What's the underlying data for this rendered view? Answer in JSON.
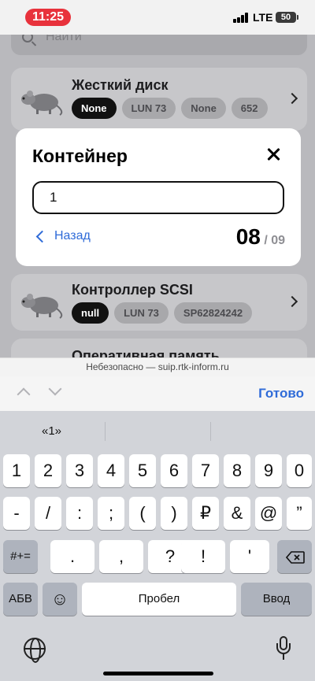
{
  "status_bar": {
    "time": "11:25",
    "network": "LTE",
    "battery": "50"
  },
  "page": {
    "search_placeholder": "Найти",
    "cards": [
      {
        "title": "Жесткий диск",
        "chips": [
          "None",
          "LUN 73",
          "None",
          "652"
        ]
      },
      {
        "title": "Контроллер SCSI",
        "chips": [
          "null",
          "LUN 73",
          "SP62824242"
        ]
      },
      {
        "title": "Оперативная память"
      }
    ]
  },
  "modal": {
    "title": "Контейнер",
    "input_value": "1",
    "back_label": "Назад",
    "current_page": "08",
    "total_pages": "/ 09"
  },
  "address_bar": "Небезопасно — suip.rtk-inform.ru",
  "toolbar": {
    "done_label": "Готово"
  },
  "keyboard": {
    "suggestion": "«1»",
    "row1": [
      "1",
      "2",
      "3",
      "4",
      "5",
      "6",
      "7",
      "8",
      "9",
      "0"
    ],
    "row2": [
      "-",
      "/",
      ":",
      ";",
      "(",
      ")",
      "₽",
      "&",
      "@",
      "”"
    ],
    "row3_mode": "#+=",
    "row3": [
      ".",
      ",",
      "?",
      "!",
      "'"
    ],
    "abc_label": "АБВ",
    "space_label": "Пробел",
    "return_label": "Ввод",
    "emoji": "☺"
  }
}
